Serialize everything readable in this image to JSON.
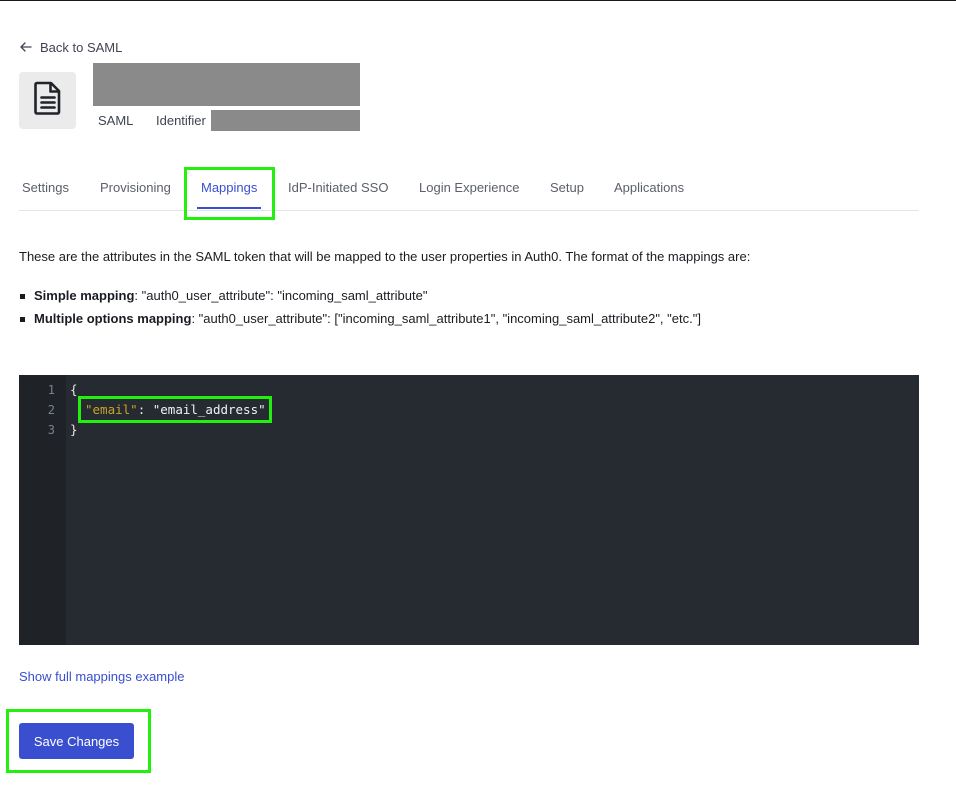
{
  "nav": {
    "back_label": "Back to SAML"
  },
  "connection": {
    "icon": "document-icon",
    "type_label": "SAML",
    "identifier_label": "Identifier"
  },
  "tabs": [
    {
      "label": "Settings",
      "active": false
    },
    {
      "label": "Provisioning",
      "active": false
    },
    {
      "label": "Mappings",
      "active": true
    },
    {
      "label": "IdP-Initiated SSO",
      "active": false
    },
    {
      "label": "Login Experience",
      "active": false
    },
    {
      "label": "Setup",
      "active": false
    },
    {
      "label": "Applications",
      "active": false
    }
  ],
  "content": {
    "intro": "These are the attributes in the SAML token that will be mapped to the user properties in Auth0. The format of the mappings are:",
    "bullets": [
      {
        "title": "Simple mapping",
        "text": ": \"auth0_user_attribute\": \"incoming_saml_attribute\""
      },
      {
        "title": "Multiple options mapping",
        "text": ": \"auth0_user_attribute\": [\"incoming_saml_attribute1\", \"incoming_saml_attribute2\", \"etc.\"]"
      }
    ]
  },
  "editor": {
    "line_numbers": [
      "1",
      "2",
      "3"
    ],
    "open_brace": "{",
    "mapping_key": "\"email\"",
    "separator": ": ",
    "mapping_value": "\"email_address\"",
    "close_brace": "}"
  },
  "links": {
    "show_full": "Show full mappings example"
  },
  "actions": {
    "save_label": "Save Changes"
  },
  "colors": {
    "accent": "#3a4fd0",
    "highlight": "#23f00f",
    "editor_bg": "#262b31",
    "json_key": "#c9a227"
  }
}
